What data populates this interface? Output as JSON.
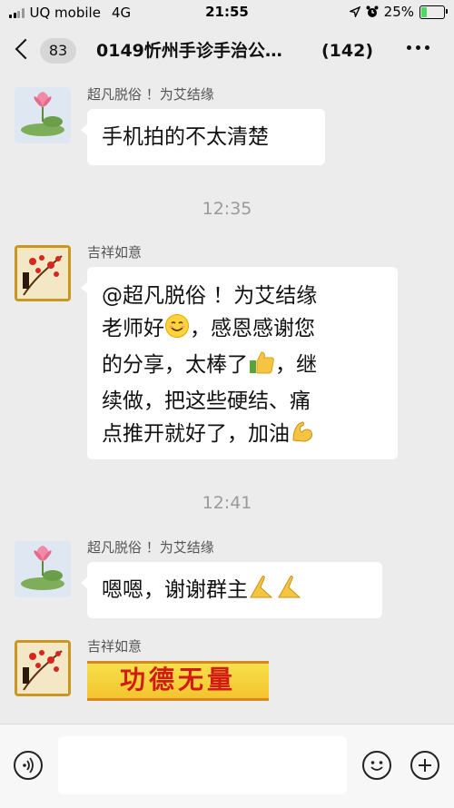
{
  "status": {
    "carrier": "UQ mobile",
    "network": "4G",
    "time": "21:55",
    "battery_pct": "25%",
    "battery_level": 0.25
  },
  "nav": {
    "unread_count": "83",
    "title": "0149忻州手诊手治公…",
    "member_count": "(142)"
  },
  "messages": [
    {
      "sender": "超凡脱俗 ！为艾结缘",
      "text": "手机拍的不太清楚"
    },
    {
      "timestamp": "12:35"
    },
    {
      "sender": "吉祥如意",
      "lines": [
        "@超凡脱俗 ！为艾结缘",
        "老师好",
        "，感恩感谢您",
        "的分享，太棒了",
        "，继",
        "续做，把这些硬结、痛",
        "点推开就好了，加油"
      ]
    },
    {
      "timestamp": "12:41"
    },
    {
      "sender": "超凡脱俗 ！为艾结缘",
      "text": "嗯嗯，谢谢群主"
    },
    {
      "sender": "吉祥如意",
      "sticker_text": "功德无量"
    }
  ],
  "input": {
    "placeholder": ""
  },
  "colors": {
    "background": "#ececec",
    "bubble": "#ffffff",
    "sticker_text": "#d21b14",
    "sticker_bg": "#f7e04a"
  },
  "icons": [
    "back-chevron-icon",
    "more-icon",
    "voice-icon",
    "emoji-icon",
    "plus-icon",
    "lotus-avatar",
    "plum-blossom-avatar",
    "location-icon",
    "alarm-icon"
  ]
}
